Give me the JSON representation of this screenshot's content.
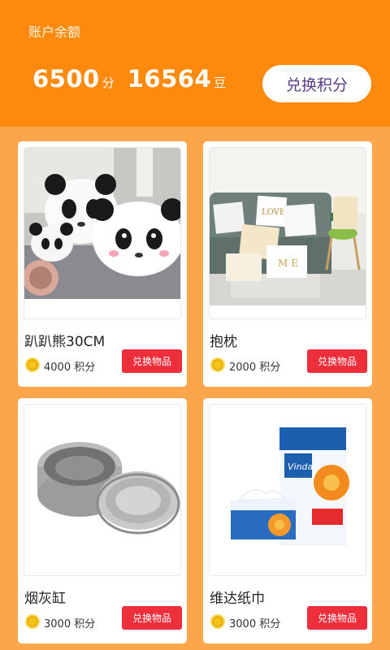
{
  "header": {
    "label": "账户余额",
    "points_value": "6500",
    "points_unit": "分",
    "beans_value": "16564",
    "beans_unit": "豆",
    "exchange_button": "兑换积分"
  },
  "products": [
    {
      "name": "趴趴熊30CM",
      "price": "4000 积分",
      "button": "兑换物品",
      "image": "panda-plush"
    },
    {
      "name": "抱枕",
      "price": "2000 积分",
      "button": "兑换物品",
      "image": "pillows-on-sofa"
    },
    {
      "name": "烟灰缸",
      "price": "3000 积分",
      "button": "兑换物品",
      "image": "steel-ashtray"
    },
    {
      "name": "维达纸巾",
      "price": "3000 积分",
      "button": "兑换物品",
      "image": "vinda-tissue"
    }
  ],
  "colors": {
    "header": "#fd8a0c",
    "background": "#fba64a",
    "buy_button": "#ee2e3a",
    "coin": "#f5c21b"
  }
}
